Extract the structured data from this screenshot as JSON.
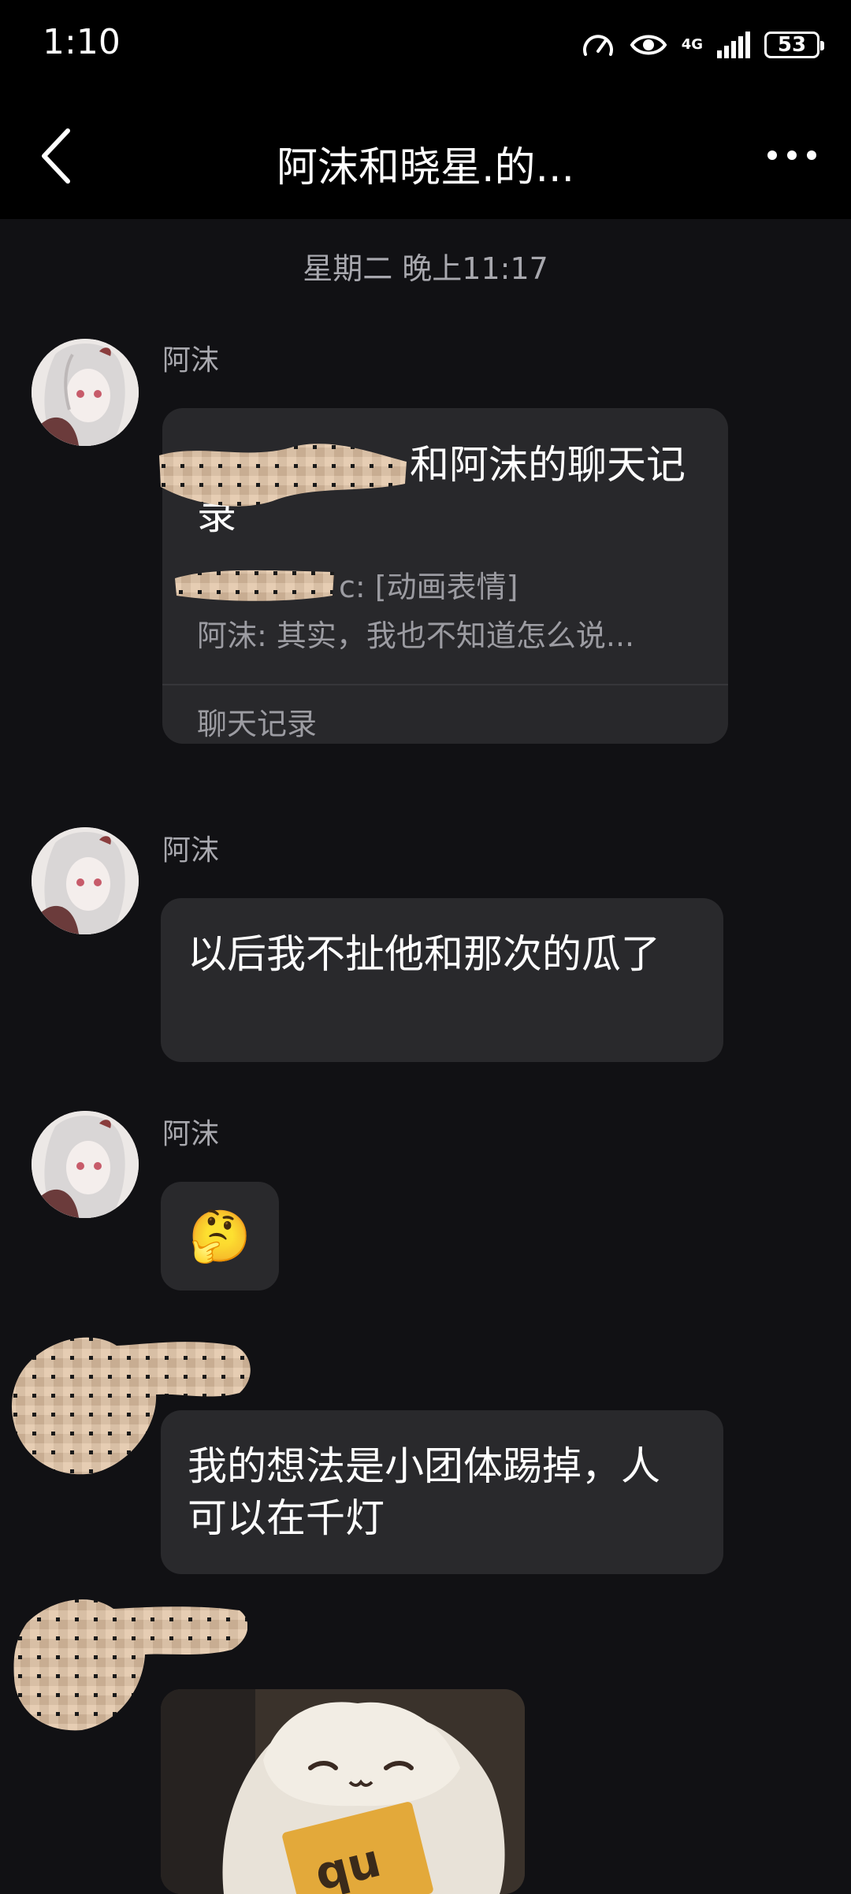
{
  "status_bar": {
    "time": "1:10",
    "network": "4G",
    "battery": "53"
  },
  "header": {
    "title": "阿沫和晓星.的..."
  },
  "timestamp": "星期二 晚上11:17",
  "messages": [
    {
      "sender": "阿沫",
      "type": "forward",
      "title_visible": "和阿沫的聊天记录",
      "line1_visible": "c: [动画表情]",
      "line2": "阿沫: 其实，我也不知道怎么说...",
      "footer": "聊天记录"
    },
    {
      "sender": "阿沫",
      "type": "text",
      "text": "以后我不扯他和那次的瓜了"
    },
    {
      "sender": "阿沫",
      "type": "emoji",
      "emoji": "🤔"
    },
    {
      "sender": "",
      "type": "text",
      "text": "我的想法是小团体踢掉，人可以在千灯"
    },
    {
      "sender": "",
      "type": "sticker",
      "sticker_text": "qu"
    }
  ],
  "colors": {
    "background": "#111114",
    "bar": "#000000",
    "bubble": "#29292c",
    "muted_text": "#a8a8ae"
  }
}
